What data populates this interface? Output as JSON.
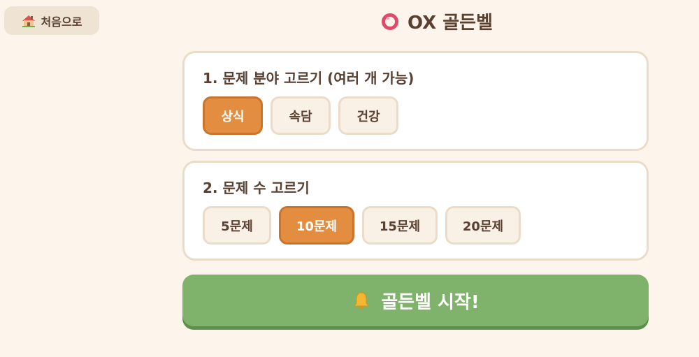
{
  "nav": {
    "home_label": "처음으로",
    "home_icon": "house-icon"
  },
  "header": {
    "title": "OX 골든벨",
    "title_icon": "ring-icon"
  },
  "category_section": {
    "label": "1. 문제 분야 고르기 (여러 개 가능)",
    "options": [
      {
        "label": "상식",
        "selected": true
      },
      {
        "label": "속담",
        "selected": false
      },
      {
        "label": "건강",
        "selected": false
      }
    ]
  },
  "count_section": {
    "label": "2. 문제 수 고르기",
    "options": [
      {
        "label": "5문제",
        "selected": false
      },
      {
        "label": "10문제",
        "selected": true
      },
      {
        "label": "15문제",
        "selected": false
      },
      {
        "label": "20문제",
        "selected": false
      }
    ]
  },
  "start": {
    "label": "골든벨 시작!",
    "icon": "bell-icon"
  },
  "colors": {
    "background": "#fdf5ec",
    "accent": "#e38d40",
    "start": "#7fb26a",
    "text": "#5a4030"
  }
}
